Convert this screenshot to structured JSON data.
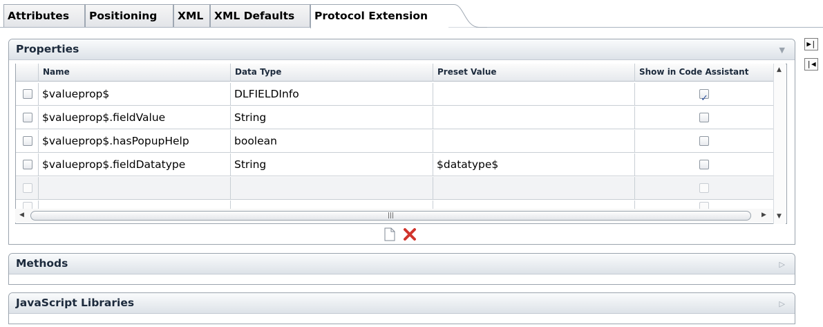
{
  "tabs": [
    {
      "label": "Attributes",
      "active": false
    },
    {
      "label": "Positioning",
      "active": false
    },
    {
      "label": "XML",
      "active": false
    },
    {
      "label": "XML Defaults",
      "active": false
    },
    {
      "label": "Protocol Extension",
      "active": true
    }
  ],
  "side_buttons": {
    "expand_icon": "expand-right-icon",
    "collapse_icon": "collapse-left-icon"
  },
  "sections": {
    "properties": {
      "title": "Properties",
      "expanded": true
    },
    "methods": {
      "title": "Methods",
      "expanded": false
    },
    "libraries": {
      "title": "JavaScript Libraries",
      "expanded": false
    }
  },
  "table": {
    "columns": [
      "Name",
      "Data Type",
      "Preset Value",
      "Show in Code Assistant"
    ],
    "rows": [
      {
        "name": "$valueprop$",
        "type": "DLFIELDInfo",
        "preset": "",
        "show": true
      },
      {
        "name": "$valueprop$.fieldValue",
        "type": "String",
        "preset": "",
        "show": false
      },
      {
        "name": "$valueprop$.hasPopupHelp",
        "type": "boolean",
        "preset": "",
        "show": false
      },
      {
        "name": "$valueprop$.fieldDatatype",
        "type": "String",
        "preset": "$datatype$",
        "show": false
      }
    ]
  },
  "actions": {
    "new_icon": "new-document-icon",
    "delete_icon": "delete-x-icon"
  },
  "colors": {
    "delete_red": "#d0342c",
    "header_text": "#1c2a3c",
    "border": "#9aa3ad"
  }
}
